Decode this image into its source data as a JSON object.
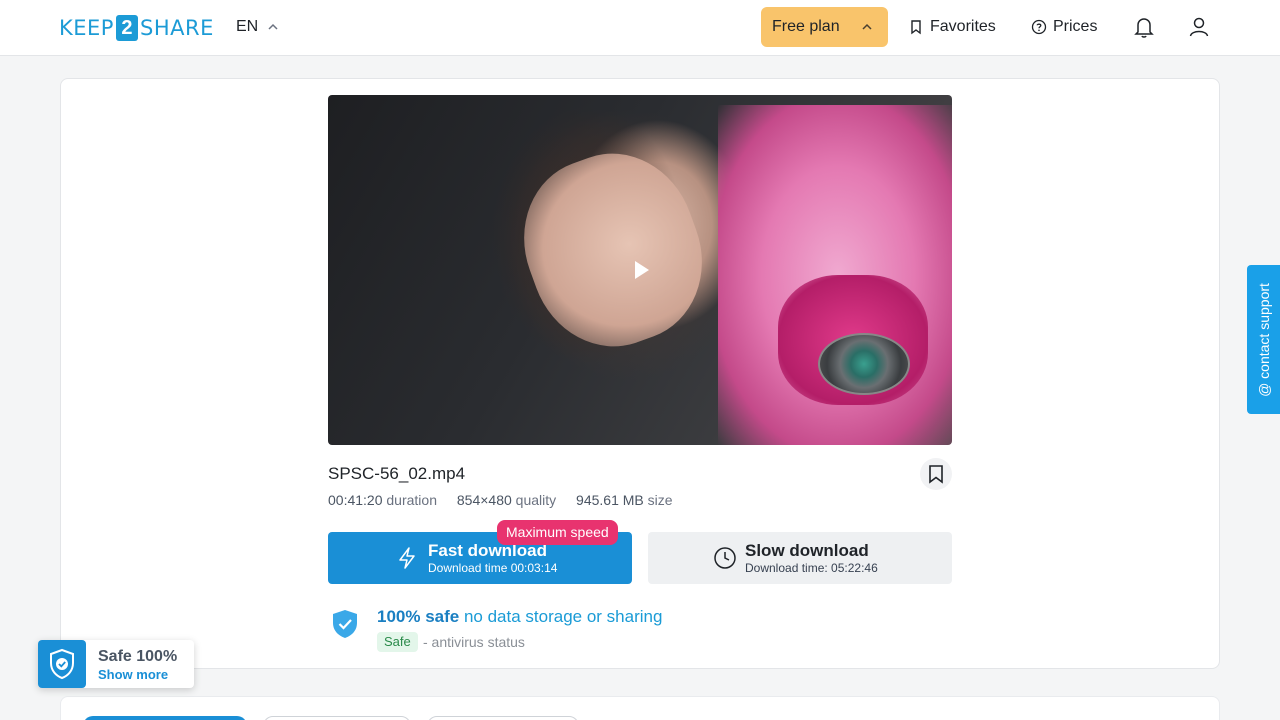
{
  "header": {
    "logo": {
      "left": "KEEP",
      "mid": "2",
      "right": "SHARE"
    },
    "language": "EN",
    "plan_label": "Free plan",
    "favorites_label": "Favorites",
    "prices_label": "Prices"
  },
  "file": {
    "name": "SPSC-56_02.mp4",
    "duration_value": "00:41:20",
    "duration_label": "duration",
    "quality_value": "854×480",
    "quality_label": "quality",
    "size_value": "945.61 MB",
    "size_label": "size"
  },
  "downloads": {
    "fast": {
      "title": "Fast download",
      "subtitle": "Download time 00:03:14",
      "badge": "Maximum speed"
    },
    "slow": {
      "title": "Slow download",
      "subtitle": "Download time: 05:22:46"
    }
  },
  "safety": {
    "headline_bold": "100% safe",
    "headline_rest": "no data storage or sharing",
    "badge": "Safe",
    "status_text": "- antivirus status"
  },
  "support_tab": "@ contact support",
  "safe_widget": {
    "title": "Safe 100%",
    "link": "Show more"
  },
  "colors": {
    "brand": "#1a8fd6",
    "plan": "#f9c46b",
    "badge": "#e8336f",
    "support": "#1aa0e8"
  }
}
